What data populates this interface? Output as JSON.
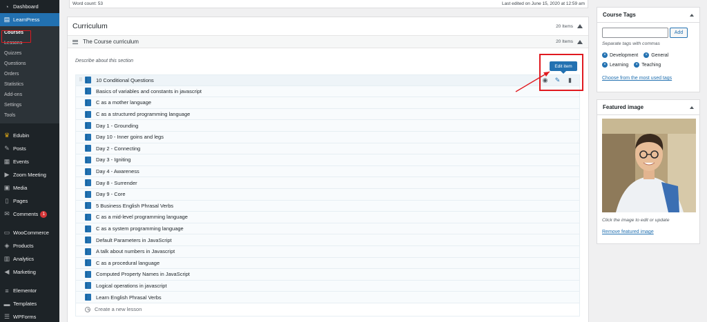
{
  "sidebar": {
    "top_items": [
      {
        "label": "Dashboard",
        "icon": "dashboard-icon"
      },
      {
        "label": "LearnPress",
        "icon": "learnpress-icon"
      }
    ],
    "submenu": [
      "Courses",
      "Lessons",
      "Quizzes",
      "Questions",
      "Orders",
      "Statistics",
      "Add-ons",
      "Settings",
      "Tools"
    ],
    "items_group2": [
      {
        "label": "Edubin",
        "icon": "edubin-icon"
      },
      {
        "label": "Posts",
        "icon": "pin-icon"
      },
      {
        "label": "Events",
        "icon": "calendar-icon"
      },
      {
        "label": "Zoom Meeting",
        "icon": "video-icon"
      },
      {
        "label": "Media",
        "icon": "media-icon"
      },
      {
        "label": "Pages",
        "icon": "page-icon"
      },
      {
        "label": "Comments",
        "icon": "comment-icon",
        "badge": "1"
      }
    ],
    "items_group3": [
      {
        "label": "WooCommerce",
        "icon": "woocommerce-icon"
      },
      {
        "label": "Products",
        "icon": "box-icon"
      },
      {
        "label": "Analytics",
        "icon": "bar-chart-icon"
      },
      {
        "label": "Marketing",
        "icon": "megaphone-icon"
      }
    ],
    "items_group4": [
      {
        "label": "Elementor",
        "icon": "elementor-icon"
      },
      {
        "label": "Templates",
        "icon": "folder-icon"
      },
      {
        "label": "WPForms",
        "icon": "form-icon"
      }
    ]
  },
  "editor_status": {
    "word_count": "Word count: 53",
    "last_edited": "Last edited on June 15, 2020 at 12:59 am"
  },
  "curriculum": {
    "title": "Curriculum",
    "items_count": "20 Items",
    "section": {
      "title": "The Course curriculum",
      "items_count": "20 Items",
      "description_placeholder": "Describe about this section"
    },
    "lessons": [
      "10 Conditional Questions",
      "Basics of variables and constants in javascript",
      "C as a mother language",
      "C as a structured programming language",
      "Day 1 - Grounding",
      "Day 10 - Inner goins and legs",
      "Day 2 - Connecting",
      "Day 3 - Igniting",
      "Day 4 - Awareness",
      "Day 8 - Surrender",
      "Day 9 - Core",
      "5 Business English Phrasal Verbs",
      "C as a mid-level programming language",
      "C as a system programming language",
      "Default Parameters in JavaScript",
      "A talk about numbers in Javascript",
      "C as a procedural language",
      "Computed Property Names in JavaScript",
      "Logical operations in javascript",
      "Learn English Phrasal Verbs"
    ],
    "create_placeholder": "Create a new lesson",
    "tooltip": "Edit item"
  },
  "course_tags": {
    "title": "Course Tags",
    "add_label": "Add",
    "help": "Separate tags with commas",
    "tags": [
      "Development",
      "General",
      "Learning",
      "Teaching"
    ],
    "choose_link": "Choose from the most used tags"
  },
  "featured_image": {
    "title": "Featured image",
    "caption": "Click the image to edit or update",
    "remove_link": "Remove featured image"
  },
  "colors": {
    "sidebar_bg": "#1d2327",
    "accent": "#2271b1",
    "annotation": "#e0191f"
  }
}
